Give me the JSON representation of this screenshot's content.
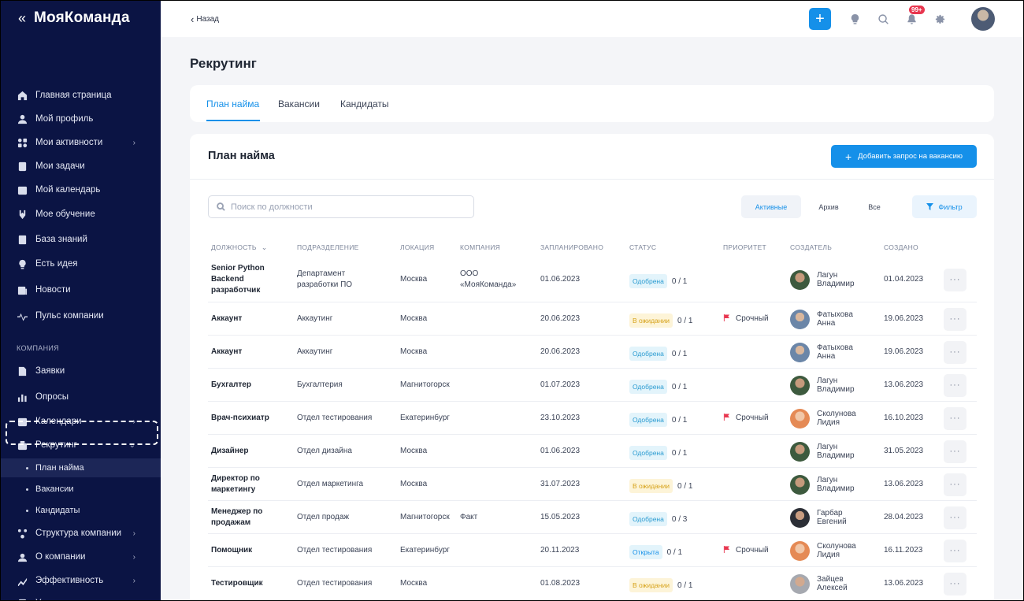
{
  "app": {
    "logo": "МояКоманда",
    "collapse_glyph": "«"
  },
  "sidebar": {
    "items": [
      {
        "label": "Главная страница",
        "icon": "home-icon",
        "has_children": false
      },
      {
        "label": "Мой профиль",
        "icon": "user-icon",
        "has_children": false
      },
      {
        "label": "Мои активности",
        "icon": "activity-grid-icon",
        "has_children": true
      },
      {
        "label": "Мои задачи",
        "icon": "tasks-icon",
        "has_children": false
      },
      {
        "label": "Мой календарь",
        "icon": "calendar-icon",
        "has_children": false
      },
      {
        "label": "Мое обучение",
        "icon": "learning-icon",
        "has_children": false
      },
      {
        "label": "База знаний",
        "icon": "knowledge-base-icon",
        "has_children": false
      },
      {
        "label": "Есть идея",
        "icon": "idea-icon",
        "has_children": false
      },
      {
        "label": "Новости",
        "icon": "news-icon",
        "has_children": false
      },
      {
        "label": "Пульс компании",
        "icon": "pulse-icon",
        "has_children": false
      }
    ],
    "section_label": "КОМПАНИЯ",
    "company_items": [
      {
        "label": "Заявки",
        "icon": "requests-icon",
        "has_children": false
      },
      {
        "label": "Опросы",
        "icon": "polls-icon",
        "has_children": false
      },
      {
        "label": "Календари",
        "icon": "calendar-icon",
        "has_children": true
      },
      {
        "label": "Рекрутинг",
        "icon": "recruiting-icon",
        "has_children": true,
        "expanded": true
      }
    ],
    "recruiting_sub": [
      {
        "label": "План найма",
        "active": true
      },
      {
        "label": "Вакансии",
        "active": false
      },
      {
        "label": "Кандидаты",
        "active": false
      }
    ],
    "bottom_items": [
      {
        "label": "Структура компании",
        "icon": "structure-icon",
        "has_children": true
      },
      {
        "label": "О компании",
        "icon": "company-icon",
        "has_children": true
      },
      {
        "label": "Эффективность",
        "icon": "efficiency-icon",
        "has_children": true
      },
      {
        "label": "Управление задачами",
        "icon": "task-management-icon",
        "has_children": false
      }
    ]
  },
  "topbar": {
    "back_label": "Назад",
    "notifications_badge": "99+"
  },
  "page": {
    "title": "Рекрутинг",
    "tabs": [
      {
        "label": "План найма",
        "active": true
      },
      {
        "label": "Вакансии",
        "active": false
      },
      {
        "label": "Кандидаты",
        "active": false
      }
    ]
  },
  "card": {
    "title": "План найма",
    "add_button": "Добавить запрос на вакансию",
    "search_placeholder": "Поиск по должности",
    "filters": [
      {
        "label": "Активные",
        "active": true
      },
      {
        "label": "Архив",
        "active": false
      },
      {
        "label": "Все",
        "active": false
      }
    ],
    "filter_button": "Фильтр"
  },
  "table": {
    "headers": [
      "ДОЛЖНОСТЬ",
      "ПОДРАЗДЕЛЕНИЕ",
      "ЛОКАЦИЯ",
      "КОМПАНИЯ",
      "ЗАПЛАНИРОВАНО",
      "СТАТУС",
      "ПРИОРИТЕТ",
      "СОЗДАТЕЛЬ",
      "СОЗДАНО"
    ],
    "rows": [
      {
        "position": "Senior Python Backend разработчик",
        "department": "Департамент разработки ПО",
        "location": "Москва",
        "company": "ООО «МояКоманда»",
        "planned": "01.06.2023",
        "status": "Одобрена",
        "status_kind": "approved",
        "count": "0 / 1",
        "priority": "",
        "creator": "Лагун Владимир",
        "avatar": "man-green",
        "created": "01.04.2023"
      },
      {
        "position": "Аккаунт",
        "department": "Аккаутинг",
        "location": "Москва",
        "company": "",
        "planned": "20.06.2023",
        "status": "В ожидании",
        "status_kind": "waiting",
        "count": "0 / 1",
        "priority": "Срочный",
        "creator": "Фатыхова Анна",
        "avatar": "woman-blue",
        "created": "19.06.2023"
      },
      {
        "position": "Аккаунт",
        "department": "Аккаутинг",
        "location": "Москва",
        "company": "",
        "planned": "20.06.2023",
        "status": "Одобрена",
        "status_kind": "approved",
        "count": "0 / 1",
        "priority": "",
        "creator": "Фатыхова Анна",
        "avatar": "woman-blue",
        "created": "19.06.2023"
      },
      {
        "position": "Бухгалтер",
        "department": "Бухгалтерия",
        "location": "Магнитогорск",
        "company": "",
        "planned": "01.07.2023",
        "status": "Одобрена",
        "status_kind": "approved",
        "count": "0 / 1",
        "priority": "",
        "creator": "Лагун Владимир",
        "avatar": "man-green",
        "created": "13.06.2023"
      },
      {
        "position": "Врач-психиатр",
        "department": "Отдел тестирования",
        "location": "Екатеринбург",
        "company": "",
        "planned": "23.10.2023",
        "status": "Одобрена",
        "status_kind": "approved",
        "count": "0 / 1",
        "priority": "Срочный",
        "creator": "Сколунова Лидия",
        "avatar": "woman-orange",
        "created": "16.10.2023"
      },
      {
        "position": "Дизайнер",
        "department": "Отдел дизайна",
        "location": "Москва",
        "company": "",
        "planned": "01.06.2023",
        "status": "Одобрена",
        "status_kind": "approved",
        "count": "0 / 1",
        "priority": "",
        "creator": "Лагун Владимир",
        "avatar": "man-green",
        "created": "31.05.2023"
      },
      {
        "position": "Директор по маркетингу",
        "department": "Отдел маркетинга",
        "location": "Москва",
        "company": "",
        "planned": "31.07.2023",
        "status": "В ожидании",
        "status_kind": "waiting",
        "count": "0 / 1",
        "priority": "",
        "creator": "Лагун Владимир",
        "avatar": "man-green",
        "created": "13.06.2023"
      },
      {
        "position": "Менеджер по продажам",
        "department": "Отдел продаж",
        "location": "Магнитогорск",
        "company": "Факт",
        "planned": "15.05.2023",
        "status": "Одобрена",
        "status_kind": "approved",
        "count": "0 / 3",
        "priority": "",
        "creator": "Гарбар Евгений",
        "avatar": "man-dark",
        "created": "28.04.2023"
      },
      {
        "position": "Помощник",
        "department": "Отдел тестирования",
        "location": "Екатеринбург",
        "company": "",
        "planned": "20.11.2023",
        "status": "Открыта",
        "status_kind": "open",
        "count": "0 / 1",
        "priority": "Срочный",
        "creator": "Сколунова Лидия",
        "avatar": "woman-orange",
        "created": "16.11.2023"
      },
      {
        "position": "Тестировщик",
        "department": "Отдел тестирования",
        "location": "Москва",
        "company": "",
        "planned": "01.08.2023",
        "status": "В ожидании",
        "status_kind": "waiting",
        "count": "0 / 1",
        "priority": "",
        "creator": "Зайцев Алексей",
        "avatar": "man-gray",
        "created": "13.06.2023"
      }
    ]
  },
  "colors": {
    "accent": "#1590e9",
    "sidebar_bg": "#0b1444",
    "urgent_flag": "#e8364f"
  }
}
